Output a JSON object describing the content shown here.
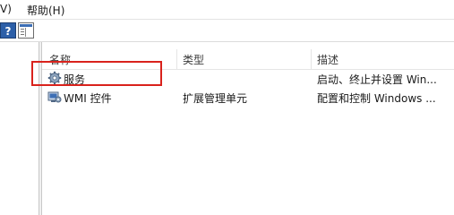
{
  "menubar": {
    "view_label": "V)",
    "help_label": "帮助(H)"
  },
  "toolbar": {
    "help_button_glyph": "?",
    "help_icon": "help-icon",
    "show_hide_tree_icon": "show-hide-console-tree-icon"
  },
  "list": {
    "columns": [
      "名称",
      "类型",
      "描述"
    ],
    "rows": [
      {
        "icon": "gear-icon",
        "name": "服务",
        "type": "",
        "description": "启动、终止并设置 Win..."
      },
      {
        "icon": "wmi-control-icon",
        "name": "WMI 控件",
        "type": "扩展管理单元",
        "description": "配置和控制 Windows ..."
      }
    ]
  },
  "colors": {
    "highlight": "#d9221c",
    "accent": "#2c5fa8"
  }
}
